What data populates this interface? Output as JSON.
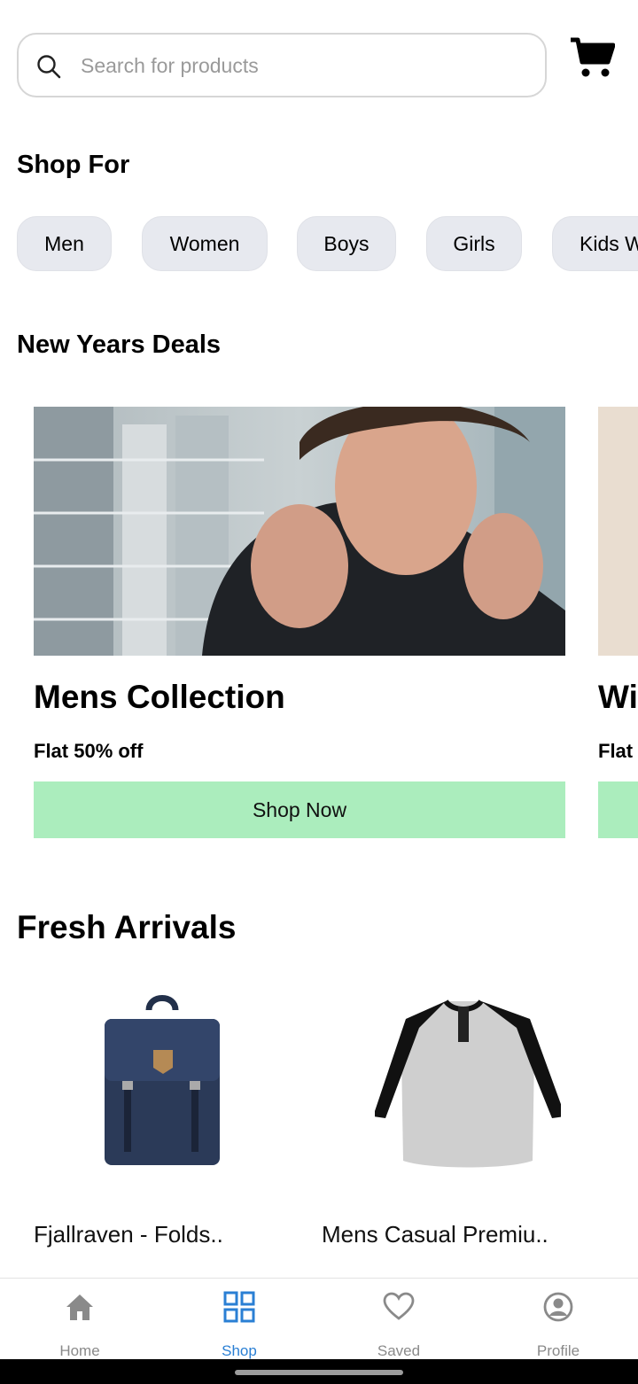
{
  "search": {
    "placeholder": "Search for products",
    "value": ""
  },
  "shop_for": {
    "heading": "Shop For",
    "chips": [
      "Men",
      "Women",
      "Boys",
      "Girls",
      "Kids W"
    ]
  },
  "deals": {
    "heading": "New Years Deals",
    "cards": [
      {
        "title": "Mens Collection",
        "subtitle": "Flat 50% off",
        "button": "Shop Now"
      },
      {
        "title": "Wi",
        "subtitle": "Flat"
      }
    ]
  },
  "fresh": {
    "heading": "Fresh Arrivals",
    "products": [
      {
        "name": "Fjallraven - Folds.."
      },
      {
        "name": "Mens Casual Premiu.."
      }
    ]
  },
  "nav": {
    "items": [
      {
        "label": "Home",
        "icon": "home-icon"
      },
      {
        "label": "Shop",
        "icon": "grid-icon",
        "active": true
      },
      {
        "label": "Saved",
        "icon": "heart-icon"
      },
      {
        "label": "Profile",
        "icon": "profile-icon"
      }
    ]
  },
  "colors": {
    "accent": "#2a7fd4",
    "deal_button": "#abedbd",
    "chip_bg": "#e7e9ef"
  }
}
